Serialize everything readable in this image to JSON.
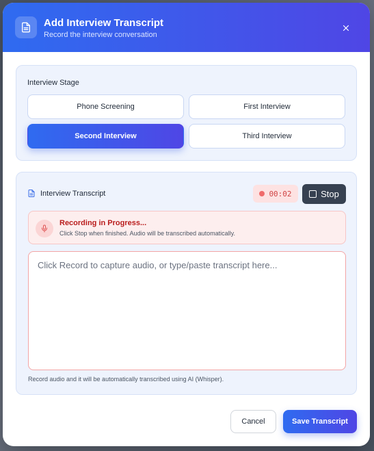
{
  "dialog": {
    "title": "Add Interview Transcript",
    "subtitle": "Record the interview conversation"
  },
  "stage": {
    "label": "Interview Stage",
    "options": [
      {
        "label": "Phone Screening",
        "selected": false
      },
      {
        "label": "First Interview",
        "selected": false
      },
      {
        "label": "Second Interview",
        "selected": true
      },
      {
        "label": "Third Interview",
        "selected": false
      }
    ]
  },
  "transcript": {
    "label": "Interview Transcript",
    "timer": "00:02",
    "stop_label": "Stop",
    "recording_title": "Recording in Progress...",
    "recording_subtitle": "Click Stop when finished. Audio will be transcribed automatically.",
    "placeholder": "Click Record to capture audio, or type/paste transcript here...",
    "value": "",
    "helper": "Record audio and it will be automatically transcribed using AI (Whisper)."
  },
  "footer": {
    "cancel_label": "Cancel",
    "save_label": "Save Transcript"
  },
  "colors": {
    "accent_start": "#2f6bf0",
    "accent_end": "#4f46e5",
    "recording_red": "#f06b6b",
    "stop_dark": "#374151"
  },
  "icons": {
    "header": "document-icon",
    "close": "close-icon",
    "transcript": "file-text-icon",
    "microphone": "microphone-icon",
    "stop": "stop-square-icon"
  }
}
